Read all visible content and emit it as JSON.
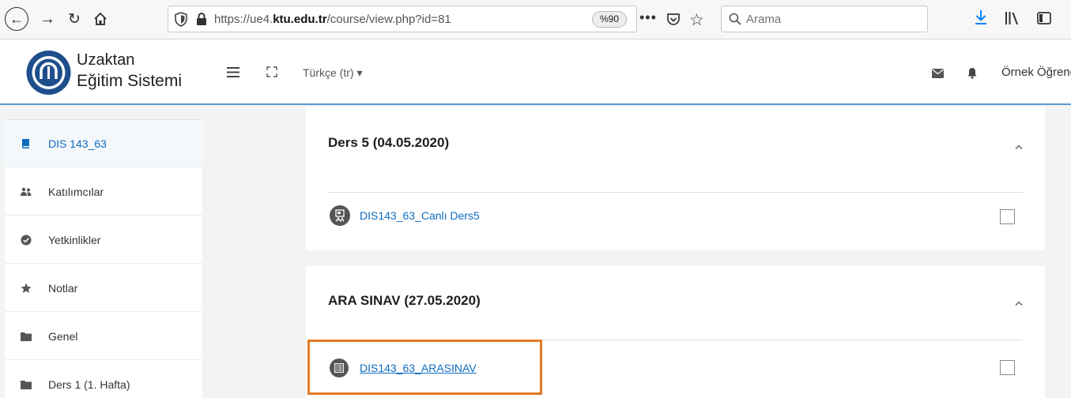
{
  "browser": {
    "url_prefix": "https://ue4.",
    "url_domain": "ktu.edu.tr",
    "url_path": "/course/view.php?id=81",
    "zoom": "%90",
    "more_label": "•••",
    "search_placeholder": "Arama"
  },
  "navbar": {
    "brand_line1": "Uzaktan",
    "brand_line2": "Eğitim Sistemi",
    "language": "Türkçe (tr) ▾",
    "user_name": "Örnek Öğrenci"
  },
  "drawer": {
    "items": [
      {
        "label": "DIS 143_63",
        "icon": "course-icon"
      },
      {
        "label": "Katılımcılar",
        "icon": "users-icon"
      },
      {
        "label": "Yetkinlikler",
        "icon": "check-circle-icon"
      },
      {
        "label": "Notlar",
        "icon": "star-icon"
      },
      {
        "label": "Genel",
        "icon": "folder-icon"
      },
      {
        "label": "Ders 1 (1. Hafta)",
        "icon": "folder-icon"
      }
    ]
  },
  "sections": [
    {
      "title": "Ders 5 (04.05.2020)",
      "activity": "DIS143_63_Canlı Ders5",
      "activity_icon": "live-class-icon"
    },
    {
      "title": "ARA SINAV (27.05.2020)",
      "activity": "DIS143_63_ARASINAV",
      "activity_icon": "quiz-icon"
    }
  ],
  "colors": {
    "link": "#0f6cbf",
    "highlight": "#e07b28",
    "header_border": "#5b9bd5"
  }
}
